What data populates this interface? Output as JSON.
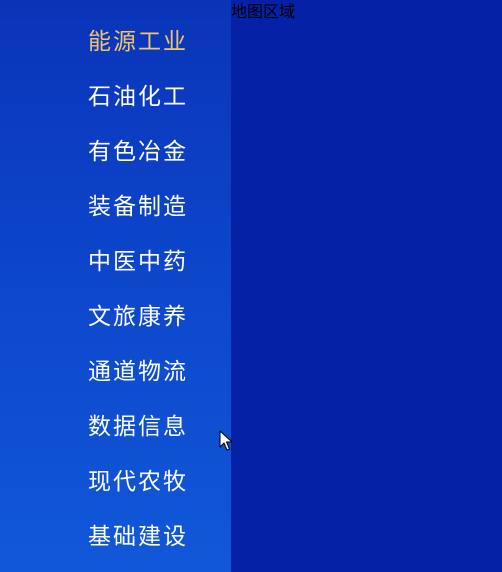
{
  "sidebar": {
    "items": [
      {
        "label": "能源工业"
      },
      {
        "label": "石油化工"
      },
      {
        "label": "有色冶金"
      },
      {
        "label": "装备制造"
      },
      {
        "label": "中医中药"
      },
      {
        "label": "文旅康养"
      },
      {
        "label": "通道物流"
      },
      {
        "label": "数据信息"
      },
      {
        "label": "现代农牧"
      },
      {
        "label": "基础建设"
      }
    ],
    "active_index": 0
  },
  "map": {
    "label": "地图区域"
  },
  "colors": {
    "active_text": "#f2c46d",
    "text": "#ffffff",
    "map_background": "#0522a6"
  },
  "icons": {
    "cursor": "mouse-pointer-icon"
  }
}
